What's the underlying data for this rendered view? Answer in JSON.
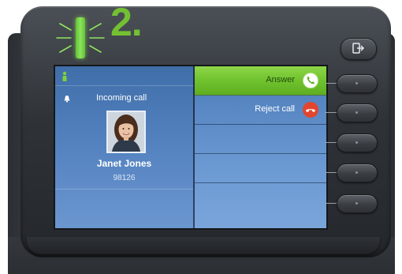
{
  "step": {
    "label": "2."
  },
  "screen": {
    "call_title": "Incoming call",
    "caller": {
      "name": "Janet Jones",
      "number": "98126"
    },
    "keys": [
      {
        "label": "Answer",
        "state": "active",
        "icon": "phone-answer-icon"
      },
      {
        "label": "Reject call",
        "state": "normal",
        "icon": "phone-reject-icon"
      },
      {
        "label": "",
        "state": "empty"
      },
      {
        "label": "",
        "state": "empty"
      },
      {
        "label": "",
        "state": "empty"
      }
    ]
  },
  "led": {
    "state": "flashing",
    "color": "#74c033"
  },
  "colors": {
    "accent_green": "#74c033",
    "reject_red": "#e2452e",
    "screen_blue": "#5785c2",
    "device_gray": "#33373c"
  }
}
